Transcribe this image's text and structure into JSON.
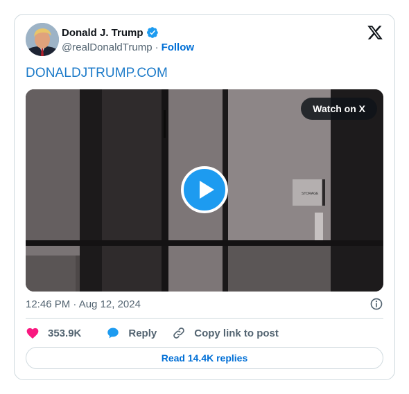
{
  "author": {
    "display_name": "Donald J. Trump",
    "handle": "@realDonaldTrump",
    "separator": "·",
    "follow_label": "Follow",
    "verified_color": "#1d9bf0"
  },
  "post": {
    "link_text": "DONALDJTRUMP.COM",
    "timestamp": "12:46 PM · Aug 12, 2024"
  },
  "media": {
    "watch_label": "Watch on X",
    "sign_text": "STORAGE"
  },
  "actions": {
    "like_count": "353.9K",
    "reply_label": "Reply",
    "copy_label": "Copy link to post"
  },
  "footer": {
    "read_replies_label": "Read 14.4K replies"
  },
  "colors": {
    "link": "#1d7bc9",
    "accent": "#006fd6",
    "like": "#f91880",
    "reply": "#1d9bf0",
    "muted": "#536471",
    "border": "#cfd9de"
  },
  "icons": {
    "logo": "x-logo-icon",
    "verified": "verified-badge-icon",
    "info": "info-icon",
    "like": "heart-icon",
    "reply": "speech-bubble-icon",
    "copy": "link-icon",
    "play": "play-icon"
  }
}
